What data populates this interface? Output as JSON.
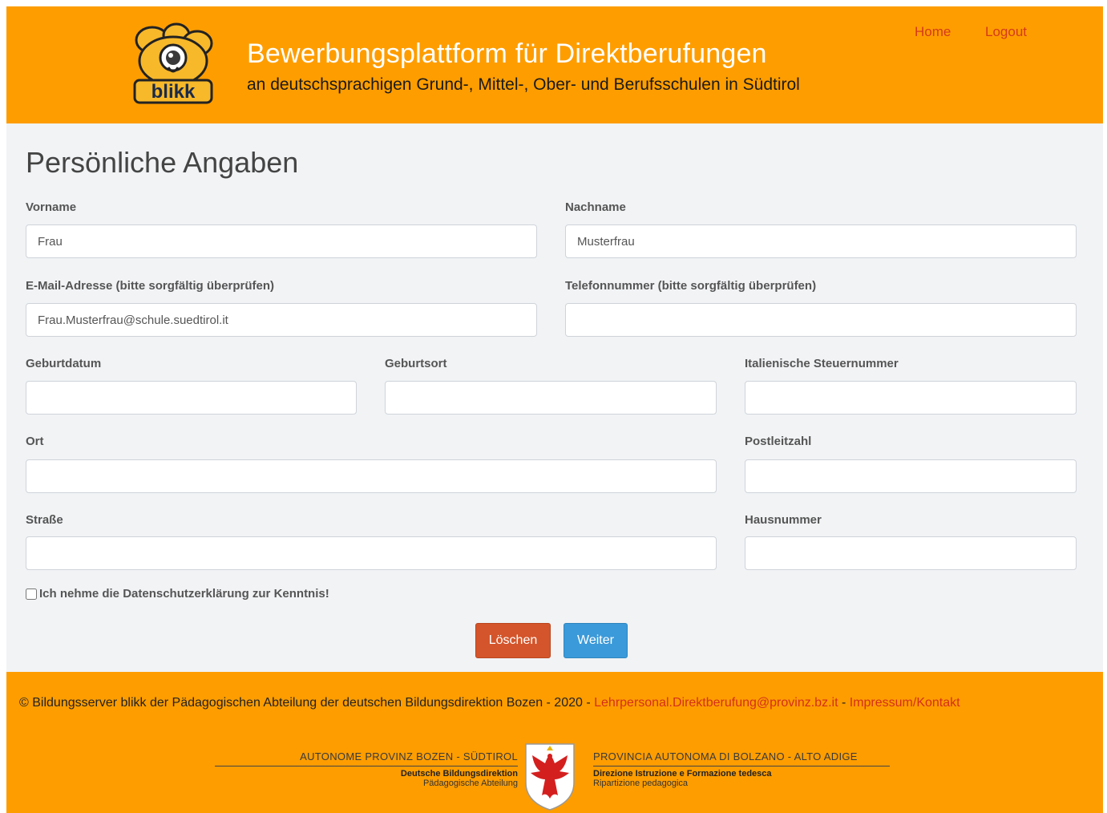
{
  "header": {
    "title": "Bewerbungsplattform für Direktberufungen",
    "subtitle": "an deutschsprachigen Grund-, Mittel-, Ober- und Berufsschulen in Südtirol",
    "logo_text": "blikk",
    "nav": {
      "home": "Home",
      "logout": "Logout"
    }
  },
  "form": {
    "title": "Persönliche Angaben",
    "fields": {
      "vorname": {
        "label": "Vorname",
        "value": "Frau"
      },
      "nachname": {
        "label": "Nachname",
        "value": "Musterfrau"
      },
      "email": {
        "label": "E-Mail-Adresse (bitte sorgfältig überprüfen)",
        "value": "Frau.Musterfrau@schule.suedtirol.it"
      },
      "telefon": {
        "label": "Telefonnummer (bitte sorgfältig überprüfen)",
        "value": ""
      },
      "geburtsdatum": {
        "label": "Geburtdatum",
        "value": ""
      },
      "geburtsort": {
        "label": "Geburtsort",
        "value": ""
      },
      "steuernummer": {
        "label": "Italienische Steuernummer",
        "value": ""
      },
      "ort": {
        "label": "Ort",
        "value": ""
      },
      "plz": {
        "label": "Postleitzahl",
        "value": ""
      },
      "strasse": {
        "label": "Straße",
        "value": ""
      },
      "hausnummer": {
        "label": "Hausnummer",
        "value": ""
      }
    },
    "consent_label": "Ich nehme die Datenschutzerklärung zur Kenntnis!",
    "consent_checked": false,
    "buttons": {
      "delete": "Löschen",
      "next": "Weiter"
    }
  },
  "footer": {
    "copyright": "© Bildungsserver blikk der Pädagogischen Abteilung der deutschen Bildungsdirektion Bozen - 2020 - ",
    "email_link": "Lehrpersonal.Direktberufung@provinz.bz.it",
    "separator": " - ",
    "impressum_link": "Impressum/Kontakt",
    "seal": {
      "left_title": "AUTONOME PROVINZ BOZEN - SÜDTIROL",
      "left_line1": "Deutsche Bildungsdirektion",
      "left_line2": "Pädagogische Abteilung",
      "right_title": "PROVINCIA AUTONOMA DI BOLZANO - ALTO ADIGE",
      "right_line1": "Direzione Istruzione e Formazione tedesca",
      "right_line2": "Ripartizione pedagogica"
    }
  },
  "colors": {
    "brand_orange": "#fe9d00",
    "link_red": "#d4301a",
    "delete_button": "#d4552b",
    "next_button": "#3b9ad9",
    "form_background": "#f1f3f5"
  },
  "icons": {
    "logo": "blikk-eye-logo",
    "seal": "tyrolean-eagle-coat-of-arms"
  }
}
